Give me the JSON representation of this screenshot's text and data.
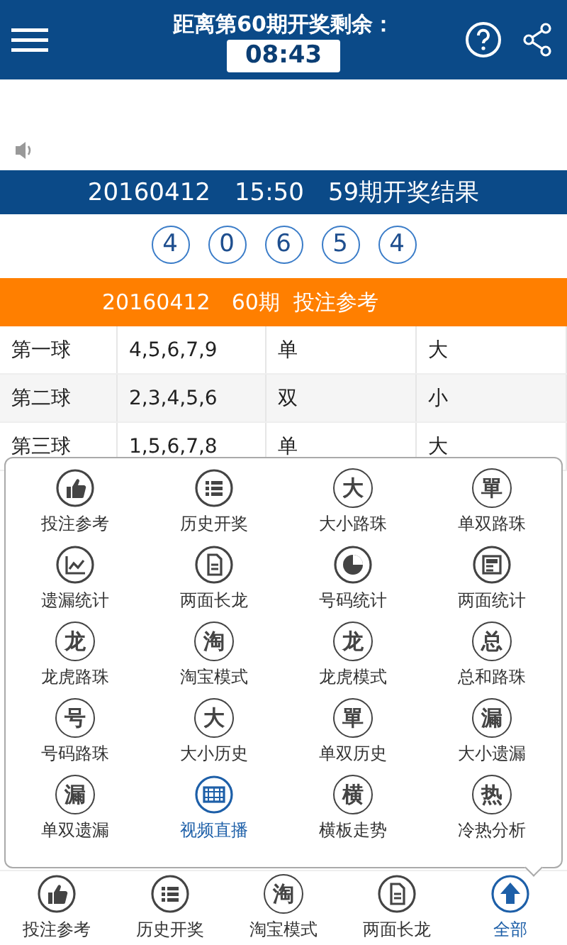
{
  "header": {
    "title": "距离第60期开奖剩余：",
    "countdown": "08:43"
  },
  "result": {
    "title": "20160412　15:50　59期开奖结果",
    "balls": [
      "4",
      "0",
      "6",
      "5",
      "4"
    ]
  },
  "reference": {
    "title": "20160412　60期  投注参考",
    "rows": [
      {
        "cells": [
          "第一球",
          "4,5,6,7,9",
          "单",
          "大"
        ]
      },
      {
        "cells": [
          "第二球",
          "2,3,4,5,6",
          "双",
          "小"
        ]
      },
      {
        "cells": [
          "第三球",
          "1,5,6,7,8",
          "单",
          "大"
        ]
      }
    ]
  },
  "menu": {
    "items": [
      {
        "label": "投注参考",
        "kind": "thumb",
        "selected": false
      },
      {
        "label": "历史开奖",
        "kind": "list",
        "selected": false
      },
      {
        "label": "大小路珠",
        "kind": "glyph",
        "glyph": "大",
        "selected": false
      },
      {
        "label": "单双路珠",
        "kind": "glyph",
        "glyph": "單",
        "selected": false
      },
      {
        "label": "遗漏统计",
        "kind": "chart",
        "selected": false
      },
      {
        "label": "两面长龙",
        "kind": "document",
        "selected": false
      },
      {
        "label": "号码统计",
        "kind": "pie",
        "selected": false
      },
      {
        "label": "两面统计",
        "kind": "news",
        "selected": false
      },
      {
        "label": "龙虎路珠",
        "kind": "glyph",
        "glyph": "龙",
        "selected": false
      },
      {
        "label": "淘宝模式",
        "kind": "glyph",
        "glyph": "淘",
        "selected": false
      },
      {
        "label": "龙虎模式",
        "kind": "glyph",
        "glyph": "龙",
        "selected": false
      },
      {
        "label": "总和路珠",
        "kind": "glyph",
        "glyph": "总",
        "selected": false
      },
      {
        "label": "号码路珠",
        "kind": "glyph",
        "glyph": "号",
        "selected": false
      },
      {
        "label": "大小历史",
        "kind": "glyph",
        "glyph": "大",
        "selected": false
      },
      {
        "label": "单双历史",
        "kind": "glyph",
        "glyph": "單",
        "selected": false
      },
      {
        "label": "大小遗漏",
        "kind": "glyph",
        "glyph": "漏",
        "selected": false
      },
      {
        "label": "单双遗漏",
        "kind": "glyph",
        "glyph": "漏",
        "selected": false
      },
      {
        "label": "视频直播",
        "kind": "video",
        "selected": true
      },
      {
        "label": "横板走势",
        "kind": "glyph",
        "glyph": "横",
        "selected": false
      },
      {
        "label": "冷热分析",
        "kind": "glyph",
        "glyph": "热",
        "selected": false
      }
    ]
  },
  "bottom_nav": [
    {
      "label": "投注参考",
      "kind": "thumb",
      "selected": false
    },
    {
      "label": "历史开奖",
      "kind": "list",
      "selected": false
    },
    {
      "label": "淘宝模式",
      "kind": "glyph",
      "glyph": "淘",
      "selected": false
    },
    {
      "label": "两面长龙",
      "kind": "document",
      "selected": false
    },
    {
      "label": "全部",
      "kind": "up",
      "selected": true
    }
  ]
}
